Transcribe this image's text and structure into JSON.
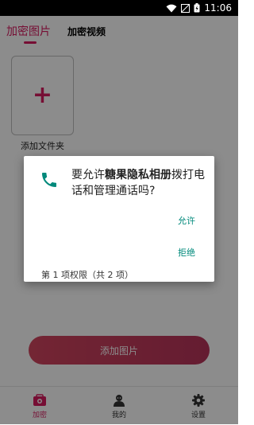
{
  "status_bar": {
    "time": "11:06",
    "icons": [
      "wifi-icon",
      "no-signal-icon",
      "battery-icon"
    ]
  },
  "tabs": {
    "active": "加密图片",
    "inactive": "加密视频"
  },
  "folder": {
    "add_label": "添加文件夹"
  },
  "main": {
    "add_image_button": "添加图片"
  },
  "bottom_nav": {
    "items": [
      {
        "label": "加密",
        "icon": "lock-icon",
        "active": true
      },
      {
        "label": "我的",
        "icon": "user-icon",
        "active": false
      },
      {
        "label": "设置",
        "icon": "gear-icon",
        "active": false
      }
    ]
  },
  "dialog": {
    "message_prefix": "要允许",
    "app_name": "糖果隐私相册",
    "message_suffix": "拨打电话和管理通话吗?",
    "allow_label": "允许",
    "deny_label": "拒绝",
    "permission_count": "第 1 项权限（共 2 项）",
    "icon": "phone-icon"
  },
  "colors": {
    "accent": "#d81b60",
    "dialog_action": "#00897b"
  }
}
